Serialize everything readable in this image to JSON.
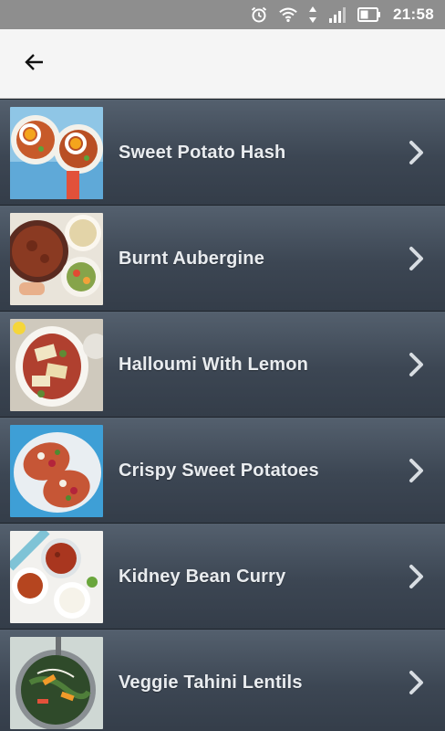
{
  "status_bar": {
    "time": "21:58",
    "icons": [
      "alarm-icon",
      "wifi-icon",
      "data-arrows-icon",
      "signal-icon",
      "battery-icon"
    ]
  },
  "app_bar": {
    "back_icon": "arrow-left-icon"
  },
  "recipes": [
    {
      "title": "Sweet Potato Hash",
      "thumb": "sweet-potato-hash-photo"
    },
    {
      "title": "Burnt Aubergine",
      "thumb": "burnt-aubergine-photo"
    },
    {
      "title": "Halloumi With Lemon",
      "thumb": "halloumi-with-lemon-photo"
    },
    {
      "title": "Crispy Sweet Potatoes",
      "thumb": "crispy-sweet-potatoes-photo"
    },
    {
      "title": "Kidney Bean Curry",
      "thumb": "kidney-bean-curry-photo"
    },
    {
      "title": "Veggie Tahini Lentils",
      "thumb": "veggie-tahini-lentils-photo"
    }
  ],
  "colors": {
    "status_bar": "#8e8e8e",
    "app_bar": "#f5f5f5",
    "row_top": "#54606e",
    "row_bottom": "#343d49",
    "label": "#e9ecef"
  }
}
